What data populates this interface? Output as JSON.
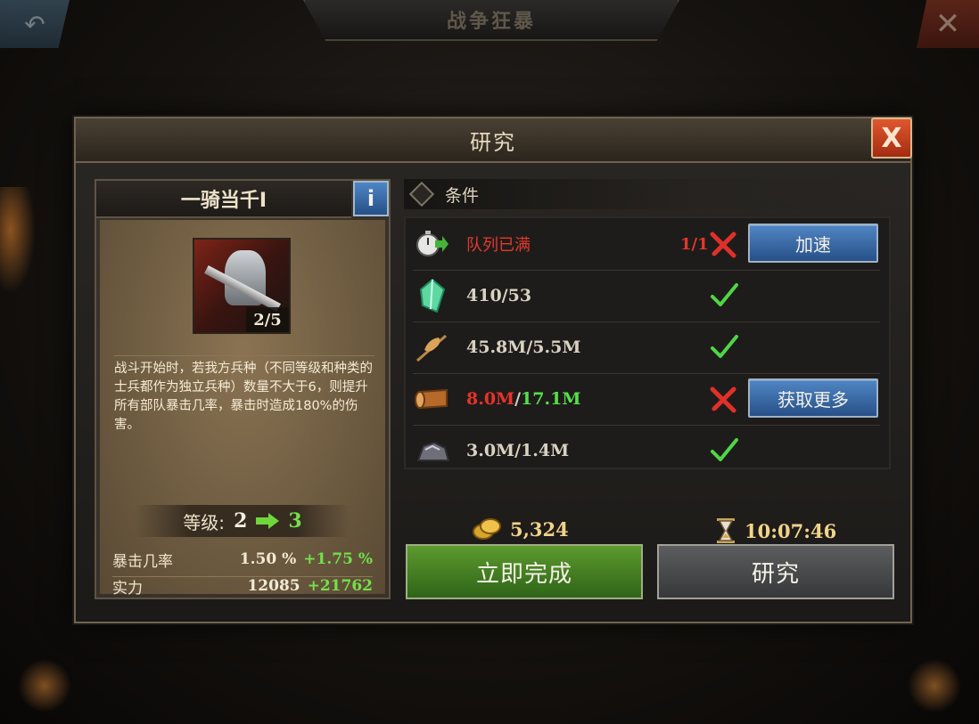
{
  "background": {
    "banner_title": "战争狂暴",
    "back_icon": "back-arrow-icon",
    "close_icon": "close-icon"
  },
  "dialog": {
    "title": "研究",
    "close_label": "X"
  },
  "skill": {
    "name": "一骑当千I",
    "info_label": "i",
    "level_progress": "2/5",
    "description": "战斗开始时，若我方兵种（不同等级和种类的士兵都作为独立兵种）数量不大于6，则提升所有部队暴击几率，暴击时造成180%的伤害。",
    "level_label": "等级:",
    "level_from": "2",
    "level_to": "3",
    "stats": [
      {
        "name": "暴击几率",
        "current": "1.50 %",
        "increase": "+1.75 %"
      },
      {
        "name": "实力",
        "current": "12085",
        "increase": "+21762"
      }
    ]
  },
  "conditions": {
    "header": "条件",
    "rows": [
      {
        "icon": "stopwatch-icon",
        "text": "队列已满",
        "quota": "1/1",
        "met": false,
        "button": "加速"
      },
      {
        "icon": "crystal-icon",
        "have": "410",
        "need": "53",
        "met": true
      },
      {
        "icon": "wheat-icon",
        "have": "45.8M",
        "need": "5.5M",
        "met": true
      },
      {
        "icon": "wood-log-icon",
        "have": "8.0M",
        "need": "17.1M",
        "met": false,
        "button": "获取更多"
      },
      {
        "icon": "iron-ore-icon",
        "have": "3.0M",
        "need": "1.4M",
        "met": true
      }
    ]
  },
  "cost": {
    "gold": "5,324",
    "time": "10:07:46"
  },
  "actions": {
    "instant_label": "立即完成",
    "research_label": "研究"
  },
  "colors": {
    "met_green": "#54e04a",
    "unmet_red": "#e8332a",
    "button_blue": "#285088",
    "button_green": "#2f6418"
  }
}
